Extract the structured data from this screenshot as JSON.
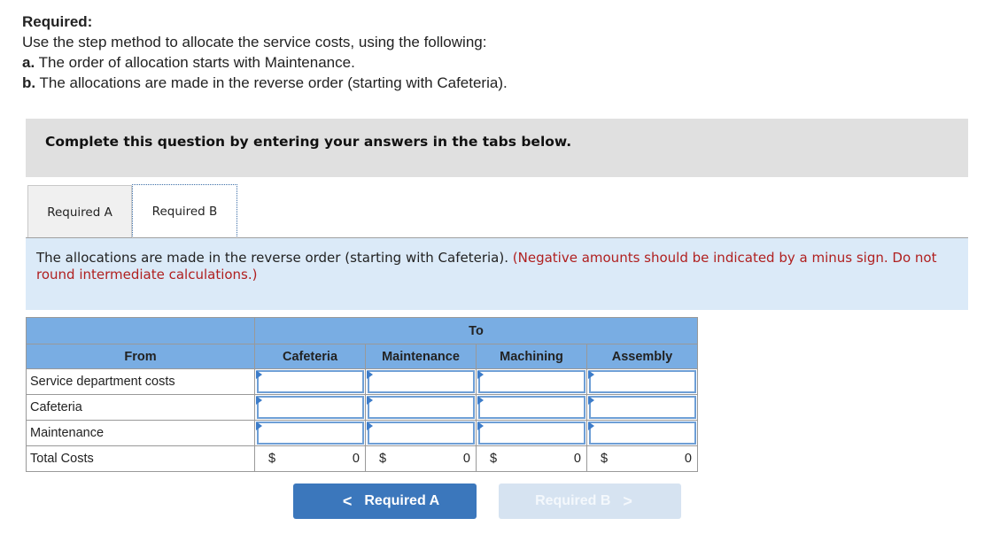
{
  "required": {
    "title": "Required:",
    "instruction": "Use the step method to allocate the service costs, using the following:",
    "items": [
      {
        "marker": "a.",
        "text": " The order of allocation starts with Maintenance."
      },
      {
        "marker": "b.",
        "text": " The allocations are made in the reverse order (starting with Cafeteria)."
      }
    ]
  },
  "instruction_bar": "Complete this question by entering your answers in the tabs below.",
  "tabs": [
    {
      "label": "Required A",
      "active": false
    },
    {
      "label": "Required B",
      "active": true
    }
  ],
  "prompt": {
    "text": "The allocations are made in the reverse order (starting with Cafeteria). ",
    "note": "(Negative amounts should be indicated by a minus sign. Do not round intermediate calculations.)"
  },
  "table": {
    "to_header": "To",
    "from_header": "From",
    "columns": [
      "Cafeteria",
      "Maintenance",
      "Machining",
      "Assembly"
    ],
    "rows": [
      {
        "label": "Service department costs",
        "values": [
          "",
          "",
          "",
          ""
        ]
      },
      {
        "label": "Cafeteria",
        "values": [
          "",
          "",
          "",
          ""
        ]
      },
      {
        "label": "Maintenance",
        "values": [
          "",
          "",
          "",
          ""
        ]
      }
    ],
    "total": {
      "label": "Total Costs",
      "currency": "$",
      "values": [
        "0",
        "0",
        "0",
        "0"
      ]
    }
  },
  "nav": {
    "prev_label": "Required A",
    "prev_icon": "chevron-left-icon",
    "next_label": "Required B",
    "next_icon": "chevron-right-icon",
    "prev_chevron": "<",
    "next_chevron": ">"
  }
}
